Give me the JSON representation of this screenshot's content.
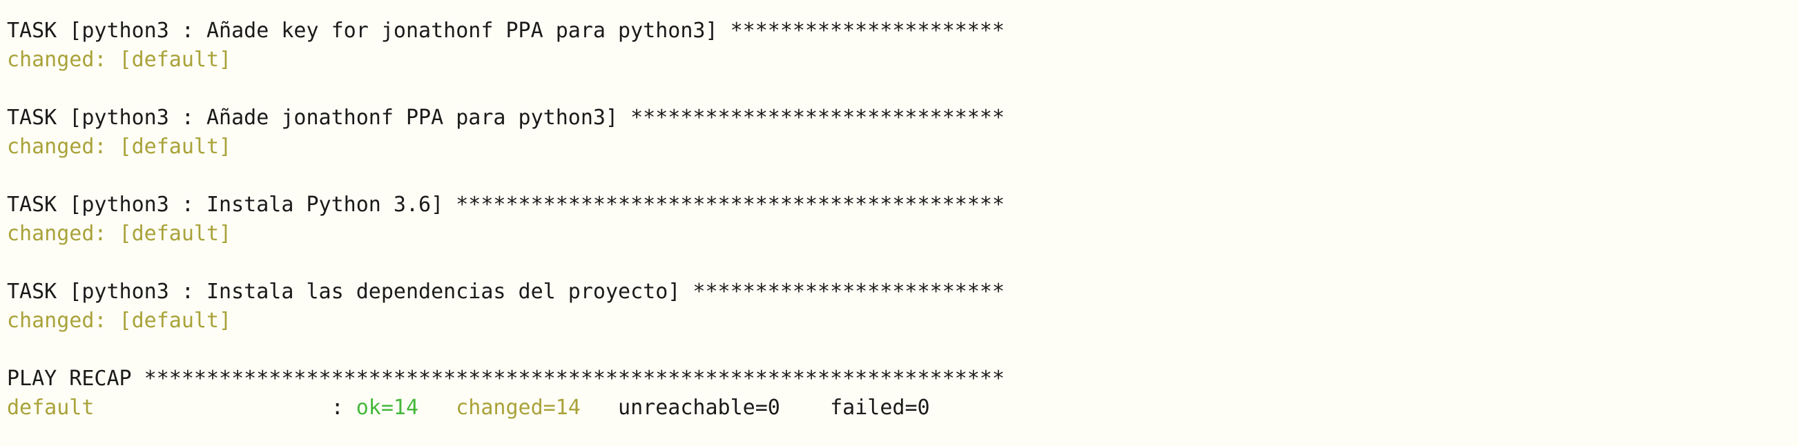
{
  "colors": {
    "background": "#fffef6",
    "text": "#1a1a1a",
    "changed": "#a9a23a",
    "ok": "#44b83a"
  },
  "tasks": [
    {
      "header": "TASK [python3 : Añade key for jonathonf PPA para python3] **********************",
      "result": "changed: [default]"
    },
    {
      "header": "TASK [python3 : Añade jonathonf PPA para python3] ******************************",
      "result": "changed: [default]"
    },
    {
      "header": "TASK [python3 : Instala Python 3.6] ********************************************",
      "result": "changed: [default]"
    },
    {
      "header": "TASK [python3 : Instala las dependencias del proyecto] *************************",
      "result": "changed: [default]"
    }
  ],
  "recap": {
    "header": "PLAY RECAP *********************************************************************",
    "host": "default",
    "separator": "                   : ",
    "ok": "ok=14",
    "gap1": "   ",
    "changed": "changed=14",
    "gap2": "   ",
    "unreachable": "unreachable=0",
    "gap3": "    ",
    "failed": "failed=0"
  }
}
